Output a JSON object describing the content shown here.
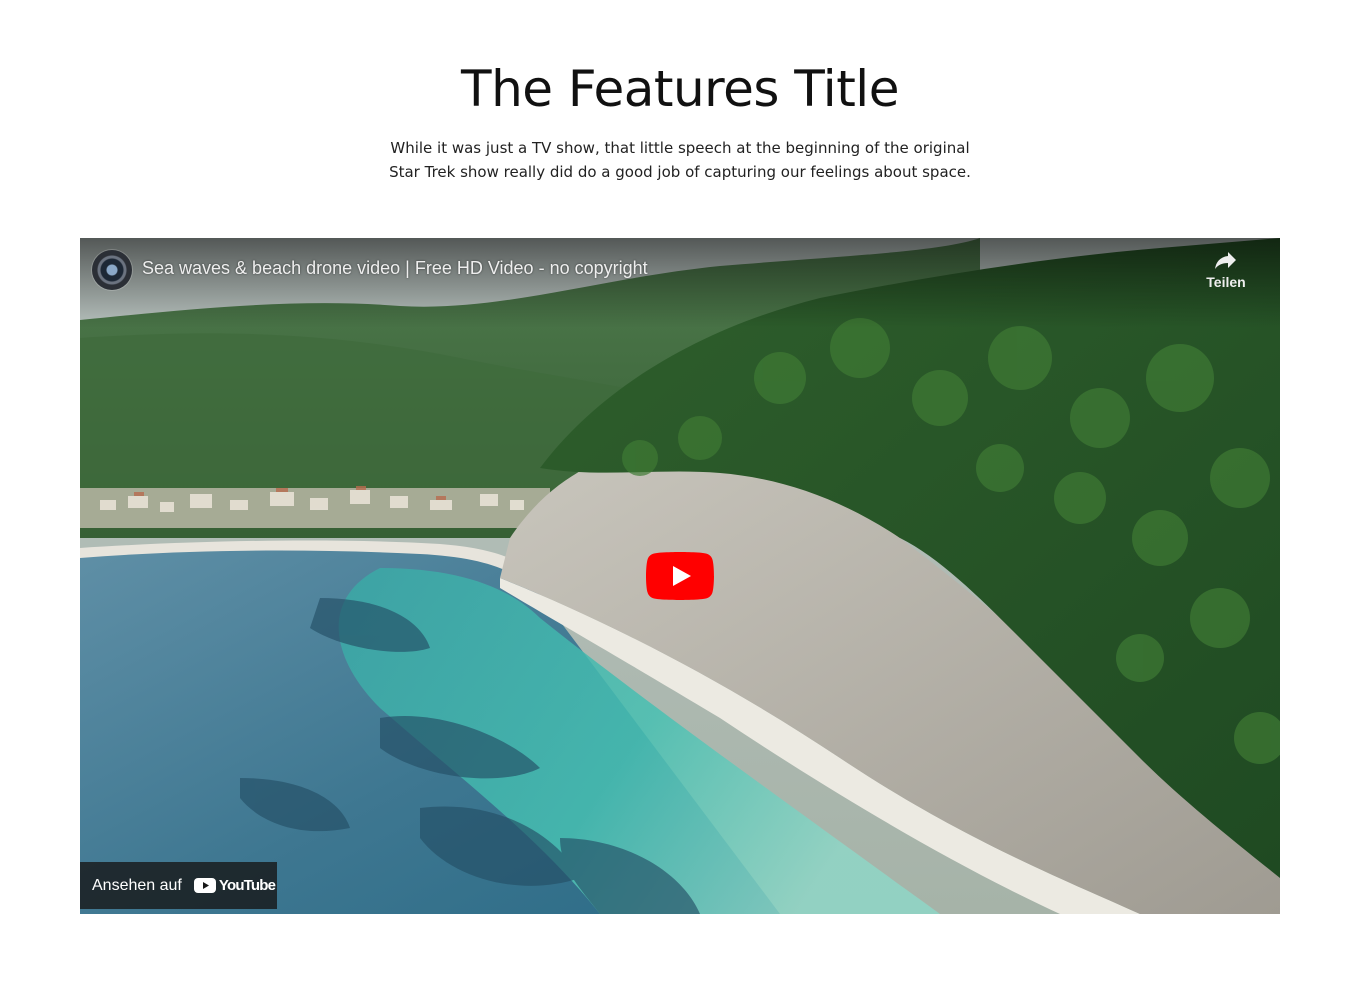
{
  "heading": {
    "title": "The Features Title",
    "subtitle_line1": "While it was just a TV show, that little speech at the beginning of the original",
    "subtitle_line2": "Star Trek show really did do a good job of capturing our feelings about space."
  },
  "video": {
    "title": "Sea waves & beach drone video | Free HD Video - no copyright",
    "share_label": "Teilen",
    "watch_on_label": "Ansehen auf",
    "platform_wordmark": "YouTube",
    "play_icon": "play-icon",
    "share_icon": "share-icon",
    "colors": {
      "play_red": "#ff0000",
      "overlay": "#171717"
    }
  }
}
